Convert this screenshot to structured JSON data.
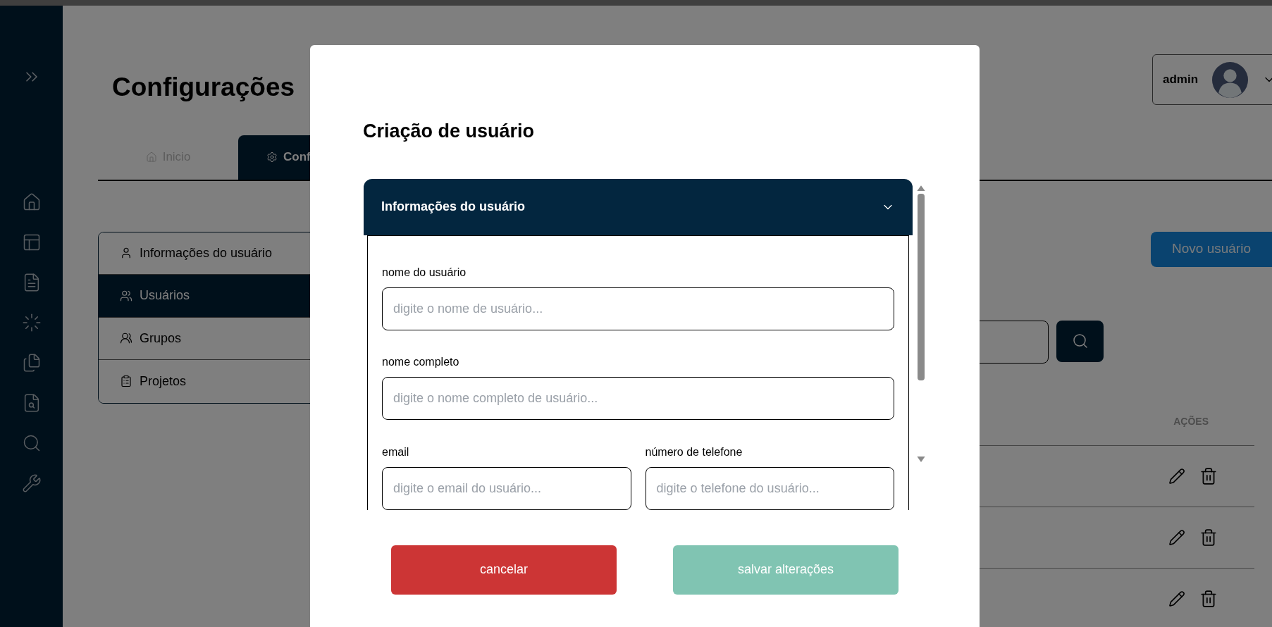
{
  "page": {
    "title": "Configurações"
  },
  "tabs": [
    {
      "label": "Inicio",
      "selected": false,
      "kind": "home"
    },
    {
      "label": "Conf",
      "selected": true,
      "kind": "settings"
    }
  ],
  "menu": [
    {
      "label": "Informações do usuário",
      "selected": false,
      "kind": "user"
    },
    {
      "label": "Usuários",
      "selected": true,
      "kind": "users"
    },
    {
      "label": "Grupos",
      "selected": false,
      "kind": "groups"
    },
    {
      "label": "Projetos",
      "selected": false,
      "kind": "projects"
    }
  ],
  "user_menu": {
    "name": "admin"
  },
  "new_user_button": {
    "label": "Novo usuário"
  },
  "table": {
    "columns": [
      "AÇÕES"
    ],
    "rows": [
      {
        "kind": "actions"
      },
      {
        "kind": "actions"
      },
      {
        "kind": "actions"
      }
    ]
  },
  "modal": {
    "title": "Criação de usuário",
    "section": {
      "title": "Informações do usuário",
      "expanded": true
    },
    "fields": [
      {
        "label": "nome do usuário",
        "placeholder": "digite o nome de usuário...",
        "kind": "full"
      },
      {
        "label": "nome completo",
        "placeholder": "digite o nome completo de usuário...",
        "kind": "full"
      },
      {
        "label": "email",
        "placeholder": "digite o email do usuário...",
        "kind": "half"
      },
      {
        "label": "número de telefone",
        "placeholder": "digite o telefone do usuário...",
        "kind": "half"
      }
    ],
    "buttons": [
      {
        "label": "cancelar",
        "kind": "cancel"
      },
      {
        "label": "salvar alterações",
        "kind": "save"
      }
    ]
  }
}
